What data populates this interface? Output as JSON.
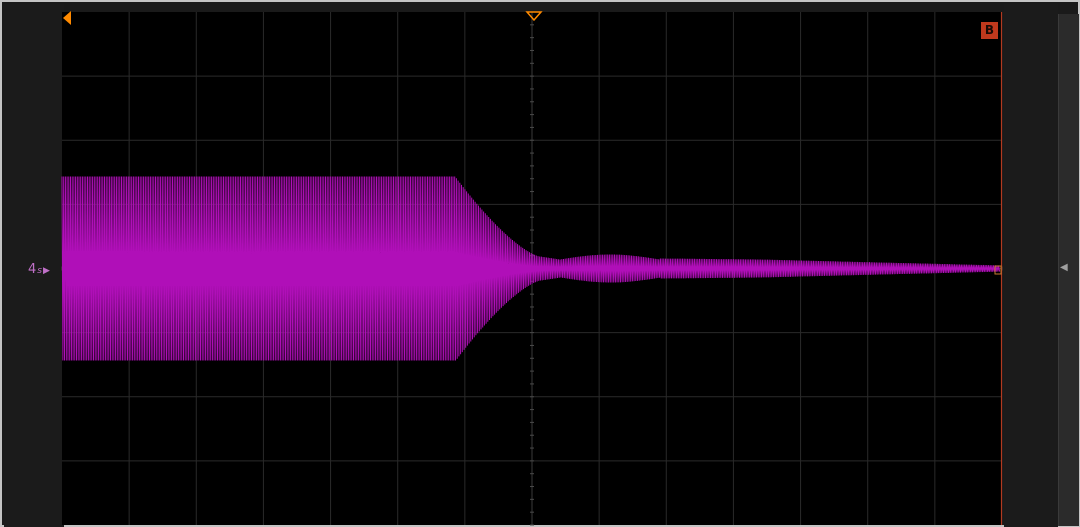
{
  "channel": {
    "label": "4",
    "subscript": "s",
    "color": "#b00fb8"
  },
  "cursor_b": {
    "label": "B",
    "color": "#c0391d"
  },
  "trigger_color": "#ff8a00",
  "grid": {
    "columns": 14,
    "rows": 8,
    "minor_per_div": 5
  },
  "icons": {
    "channel_marker": "triangle-right-icon",
    "trigger_position": "triangle-down-icon",
    "run_marker": "triangle-left-icon",
    "expand_panel": "chevron-left-icon"
  }
}
